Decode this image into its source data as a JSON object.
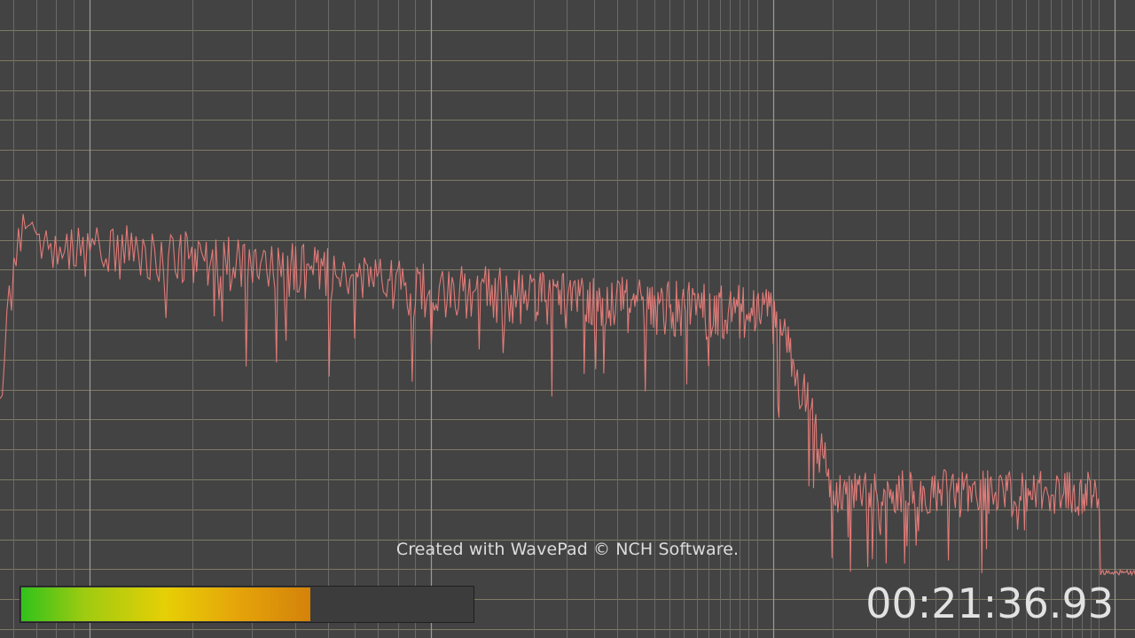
{
  "app": {
    "watermark": "Created with WavePad © NCH Software.",
    "time": "00:21:36.93",
    "level_meter": {
      "fraction": 0.64
    }
  },
  "colors": {
    "background": "#434343",
    "grid_horizontal": "#7d7a64",
    "grid_vertical": "#6a6a6a",
    "grid_vertical_major": "#9a9a9a",
    "trace": "#e07b78"
  }
}
